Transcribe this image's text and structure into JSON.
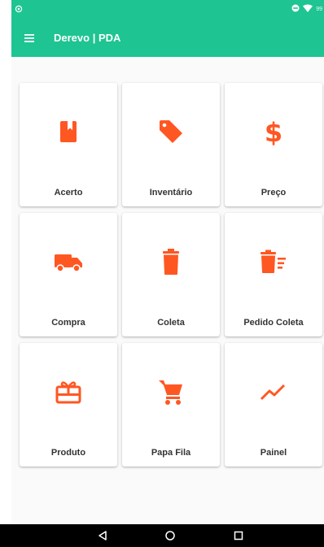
{
  "colors": {
    "primary": "#1ec491",
    "accent": "#ff5722",
    "tile_bg": "#ffffff",
    "label": "#333333",
    "nav_bg": "#000000"
  },
  "status_bar": {
    "battery_text": "99"
  },
  "app_bar": {
    "title": "Derevo | PDA",
    "menu_icon": "hamburger-menu-icon"
  },
  "tiles": [
    {
      "label": "Acerto",
      "icon": "book-icon"
    },
    {
      "label": "Inventário",
      "icon": "tag-icon"
    },
    {
      "label": "Preço",
      "icon": "dollar-icon"
    },
    {
      "label": "Compra",
      "icon": "truck-icon"
    },
    {
      "label": "Coleta",
      "icon": "trash-icon"
    },
    {
      "label": "Pedido Coleta",
      "icon": "trash-list-icon"
    },
    {
      "label": "Produto",
      "icon": "gift-card-icon"
    },
    {
      "label": "Papa Fila",
      "icon": "shopping-cart-icon"
    },
    {
      "label": "Painel",
      "icon": "trending-up-icon"
    }
  ],
  "nav_bar": {
    "buttons": [
      "back-icon",
      "home-icon",
      "recents-icon"
    ]
  }
}
